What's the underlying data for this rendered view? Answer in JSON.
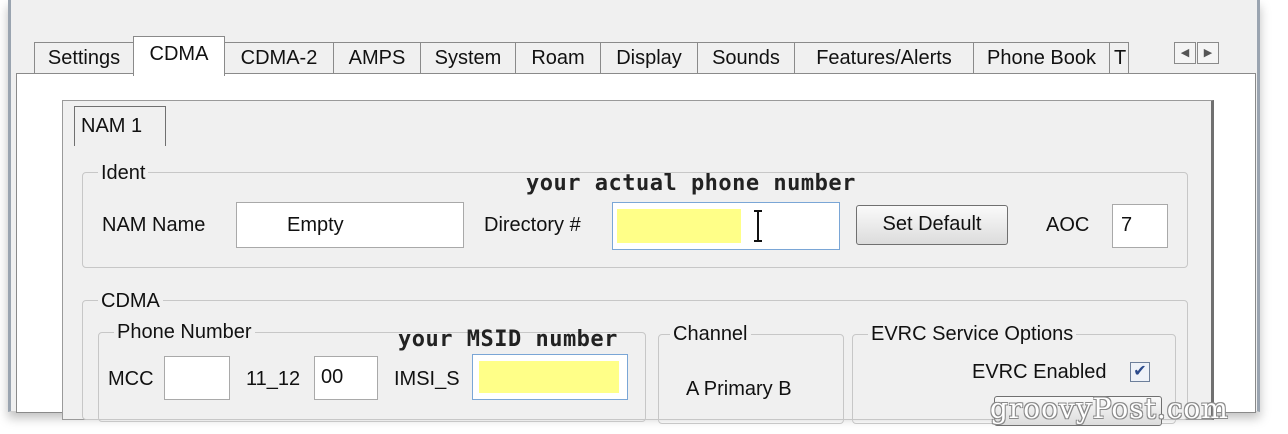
{
  "tabs": [
    {
      "label": "Settings"
    },
    {
      "label": "CDMA"
    },
    {
      "label": "CDMA-2"
    },
    {
      "label": "AMPS"
    },
    {
      "label": "System"
    },
    {
      "label": "Roam"
    },
    {
      "label": "Display"
    },
    {
      "label": "Sounds"
    },
    {
      "label": "Features/Alerts"
    },
    {
      "label": "Phone Book"
    },
    {
      "label": "T"
    }
  ],
  "active_tab": "CDMA",
  "nam_tab": "NAM 1",
  "ident": {
    "group_label": "Ident",
    "nam_name_label": "NAM Name",
    "nam_name_value": "Empty",
    "directory_label": "Directory #",
    "directory_value": "",
    "set_default_label": "Set Default",
    "aoc_label": "AOC",
    "aoc_value": "7"
  },
  "cdma": {
    "group_label": "CDMA",
    "phone_number_label": "Phone Number",
    "mcc_label": "MCC",
    "mcc_value": "",
    "i11_12_label": "11_12",
    "i11_12_value": "00",
    "imsi_s_label": "IMSI_S",
    "imsi_s_value": "",
    "channel_label": "Channel",
    "channel_value": "A  Primary  B",
    "evrc_group_label": "EVRC Service Options",
    "evrc_enabled_label": "EVRC Enabled",
    "evrc_enabled": true
  },
  "annotations": {
    "phone_number_note": "your actual phone number",
    "msid_note": "your MSID number"
  },
  "watermark": "groovyPost.com",
  "colors": {
    "highlight": "#ffff88",
    "window_bg": "#f0f0f0",
    "tab_active_bg": "#ffffff"
  },
  "icons": {
    "scroll_left": "triangle-left-icon",
    "scroll_right": "triangle-right-icon",
    "text_cursor": "ibeam-cursor-icon",
    "check": "checkmark-icon"
  }
}
